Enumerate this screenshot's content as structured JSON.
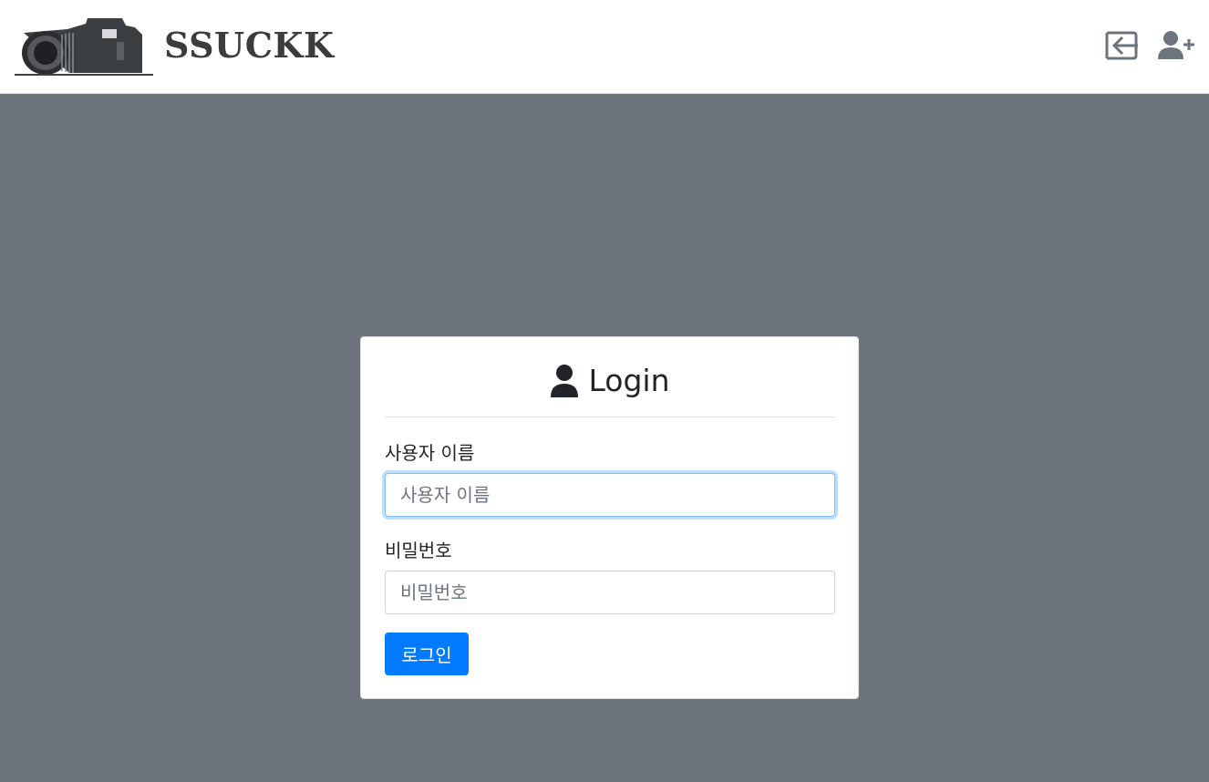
{
  "navbar": {
    "brand_text": "SSUCKK",
    "icons": {
      "login": "login-icon",
      "signup": "user-plus-icon",
      "logo": "camera-icon"
    }
  },
  "login_card": {
    "title": "Login",
    "title_icon": "user-icon",
    "username_label": "사용자 이름",
    "username_placeholder": "사용자 이름",
    "username_value": "",
    "password_label": "비밀번호",
    "password_placeholder": "비밀번호",
    "password_value": "",
    "submit_label": "로그인"
  },
  "colors": {
    "background": "#6c737d",
    "primary": "#007bff",
    "focus_border": "#80bdff",
    "icon_gray": "#6c757d"
  }
}
